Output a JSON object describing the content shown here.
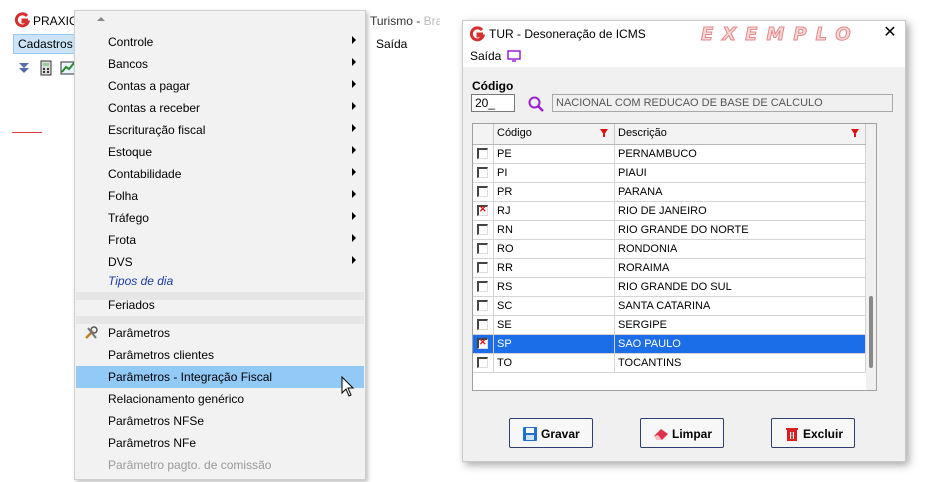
{
  "app": {
    "name": "PRAXIO",
    "subtitle": "Turismo - ",
    "subtitle_faded": "Bra",
    "menubar": {
      "cadastros": "Cadastros",
      "saida": "Saída"
    }
  },
  "menu": {
    "items": [
      {
        "label": "Controle"
      },
      {
        "label": "Bancos"
      },
      {
        "label": "Contas a pagar"
      },
      {
        "label": "Contas a receber"
      },
      {
        "label": "Escrituração fiscal"
      },
      {
        "label": "Estoque"
      },
      {
        "label": "Contabilidade"
      },
      {
        "label": "Folha"
      },
      {
        "label": "Tráfego"
      },
      {
        "label": "Frota"
      },
      {
        "label": "DVS"
      },
      {
        "label": "Tipos de dia"
      },
      {
        "label": "Feriados"
      },
      {
        "label": "Parâmetros"
      },
      {
        "label": "Parâmetros clientes"
      },
      {
        "label": "Parâmetros - Integração Fiscal"
      },
      {
        "label": "Relacionamento genérico"
      },
      {
        "label": "Parâmetros NFSe"
      },
      {
        "label": "Parâmetros NFe"
      },
      {
        "label": "Parâmetro pagto. de comissão"
      }
    ]
  },
  "dialog": {
    "title": "TUR - Desoneração de ICMS",
    "watermark": "EXEMPLO",
    "close": "✕",
    "menu_saida": "Saída",
    "codigo_label": "Código",
    "codigo_value": "20_",
    "descricao_value": "NACIONAL COM REDUCAO DE BASE DE CALCULO",
    "grid": {
      "headers": {
        "codigo": "Código",
        "descricao": "Descrição"
      },
      "rows": [
        {
          "codigo": "PE",
          "descricao": "PERNAMBUCO",
          "checked": false
        },
        {
          "codigo": "PI",
          "descricao": "PIAUI",
          "checked": false
        },
        {
          "codigo": "PR",
          "descricao": "PARANA",
          "checked": false
        },
        {
          "codigo": "RJ",
          "descricao": "RIO DE JANEIRO",
          "checked": true
        },
        {
          "codigo": "RN",
          "descricao": "RIO GRANDE DO NORTE",
          "checked": false
        },
        {
          "codigo": "RO",
          "descricao": "RONDONIA",
          "checked": false
        },
        {
          "codigo": "RR",
          "descricao": "RORAIMA",
          "checked": false
        },
        {
          "codigo": "RS",
          "descricao": "RIO GRANDE DO SUL",
          "checked": false
        },
        {
          "codigo": "SC",
          "descricao": "SANTA CATARINA",
          "checked": false
        },
        {
          "codigo": "SE",
          "descricao": "SERGIPE",
          "checked": false
        },
        {
          "codigo": "SP",
          "descricao": "SAO PAULO",
          "checked": true,
          "selected": true
        },
        {
          "codigo": "TO",
          "descricao": "TOCANTINS",
          "checked": false
        }
      ]
    },
    "buttons": {
      "gravar": "Gravar",
      "limpar": "Limpar",
      "excluir": "Excluir"
    }
  },
  "colors": {
    "selection": "#1c6ee8",
    "menu_highlight": "#91c9f7",
    "filter": "#dd1111",
    "logo": "#d32f2f"
  }
}
